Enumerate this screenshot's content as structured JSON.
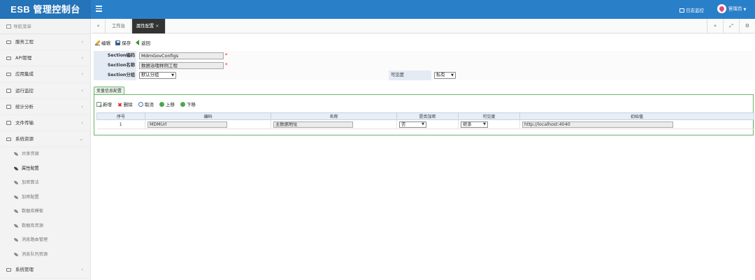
{
  "app": {
    "title": "ESB 管理控制台"
  },
  "header": {
    "log_link": "日志监控",
    "user": "管理员"
  },
  "sidebar": {
    "title": "导航菜单",
    "items_top": [
      {
        "label": "服务工程",
        "arrow": "‹"
      },
      {
        "label": "API管理",
        "arrow": "‹"
      },
      {
        "label": "应用集成",
        "arrow": "‹"
      },
      {
        "label": "运行监控",
        "arrow": "‹"
      },
      {
        "label": "统计分析",
        "arrow": "‹"
      },
      {
        "label": "文件传输",
        "arrow": "‹"
      },
      {
        "label": "系统资源",
        "arrow": "⌄"
      }
    ],
    "sub_items": [
      {
        "label": "共享资源"
      },
      {
        "label": "属性配置"
      },
      {
        "label": "加密算法"
      },
      {
        "label": "加密配置"
      },
      {
        "label": "数据库模板"
      },
      {
        "label": "数据库资源"
      },
      {
        "label": "消息路由管理"
      },
      {
        "label": "消息队列资源"
      }
    ],
    "items_bottom": [
      {
        "label": "系统管理",
        "arrow": "‹"
      }
    ]
  },
  "tabs": {
    "home": "工作台",
    "active": "属性配置",
    "close_symbol": "×"
  },
  "toolbar": {
    "edit": "编辑",
    "save": "保存",
    "back": "返回"
  },
  "form": {
    "section_code_label": "Section编码",
    "section_code_value": "MdmGovConfigs",
    "section_name_label": "Section名称",
    "section_name_value": "数据治理样例工程",
    "section_group_label": "Section分组",
    "section_group_value": "默认分组",
    "visibility_label": "可见度",
    "visibility_value": "私有",
    "required_mark": "*"
  },
  "variables_panel": {
    "tab_label": "变量信息配置",
    "toolbar": {
      "add": "新增",
      "delete": "删除",
      "cancel": "取消",
      "up": "上移",
      "down": "下移"
    },
    "columns": [
      "序号",
      "编码",
      "名称",
      "是否加密",
      "可见度",
      "初始值"
    ],
    "rows": [
      {
        "index": "1",
        "code": "MDMUrl",
        "name": "主数据地址",
        "encrypted": "否",
        "visibility": "继承",
        "initial_value": "http://localhost:4040"
      }
    ]
  },
  "colors": {
    "header_blue": "#2a7fc9",
    "brand_blue": "#2573b8",
    "active_tab": "#333333",
    "panel_green": "#6bb36b"
  }
}
